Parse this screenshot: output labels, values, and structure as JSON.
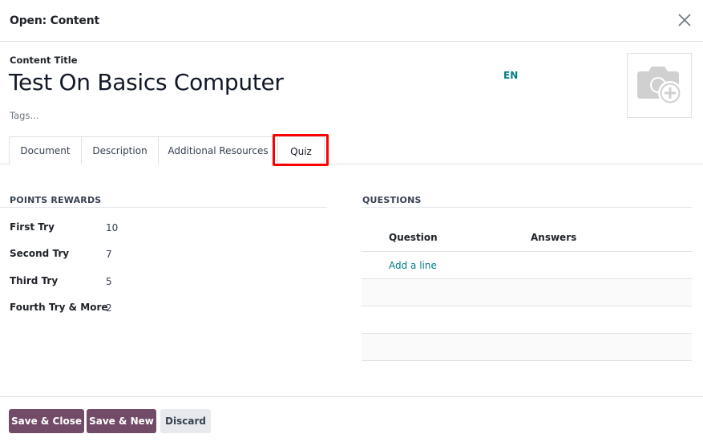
{
  "dialog": {
    "title": "Open: Content",
    "close_icon": "close-icon"
  },
  "form": {
    "title_label": "Content Title",
    "title_value": "Test On Basics Computer",
    "tags_placeholder": "Tags...",
    "language": "EN",
    "image_icon": "camera-add-icon"
  },
  "tabs": [
    {
      "label": "Document",
      "active": false
    },
    {
      "label": "Description",
      "active": false
    },
    {
      "label": "Additional Resources",
      "active": false
    },
    {
      "label": "Quiz",
      "active": true
    }
  ],
  "points_rewards": {
    "title": "POINTS REWARDS",
    "fields": [
      {
        "label": "First Try",
        "value": "10"
      },
      {
        "label": "Second Try",
        "value": "7"
      },
      {
        "label": "Third Try",
        "value": "5"
      },
      {
        "label": "Fourth Try & More",
        "value": "2"
      }
    ]
  },
  "questions": {
    "title": "QUESTIONS",
    "columns": [
      "Question",
      "Answers"
    ],
    "add_line_label": "Add a line",
    "rows": []
  },
  "footer": {
    "save_close_label": "Save & Close",
    "save_new_label": "Save & New",
    "discard_label": "Discard"
  },
  "colors": {
    "primary": "#714b67",
    "link": "#017e84",
    "annotation": "#ff0000"
  }
}
